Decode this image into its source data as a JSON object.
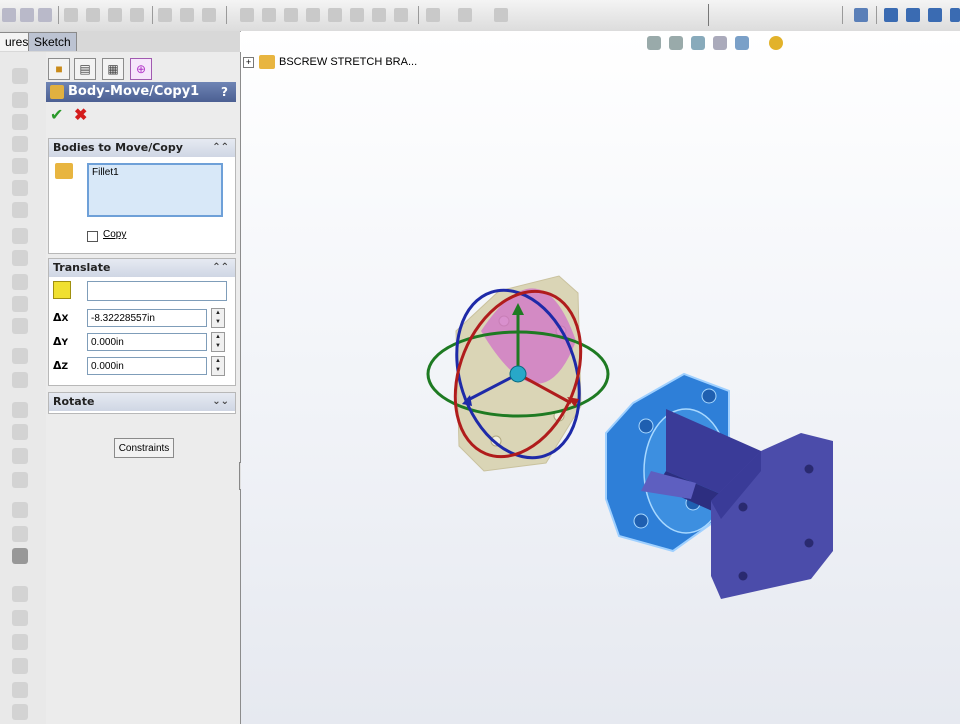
{
  "toolbar": {
    "left_tab_partial": "ures",
    "sketch_tab": "Sketch"
  },
  "feature_tree": {
    "root_label": "BSCREW STRETCH BRA..."
  },
  "property_manager": {
    "title": "Body-Move/Copy1",
    "help": "?",
    "bodies_group": {
      "header": "Bodies to Move/Copy",
      "items": [
        "Fillet1"
      ],
      "copy_label": "Copy",
      "copy_checked": false
    },
    "translate_group": {
      "header": "Translate",
      "reference_value": "",
      "dx_label": "X",
      "dx_value": "-8.32228557in",
      "dy_label": "Y",
      "dy_value": "0.000in",
      "dz_label": "Z",
      "dz_value": "0.000in"
    },
    "rotate_group": {
      "header": "Rotate"
    },
    "constraints_button": "Constraints"
  },
  "colors": {
    "body_selected": "#2e7fd8",
    "body_blue": "#4b4caa",
    "ghost_body": "#d7d2b0",
    "pm_title": "#5a6ea3"
  }
}
